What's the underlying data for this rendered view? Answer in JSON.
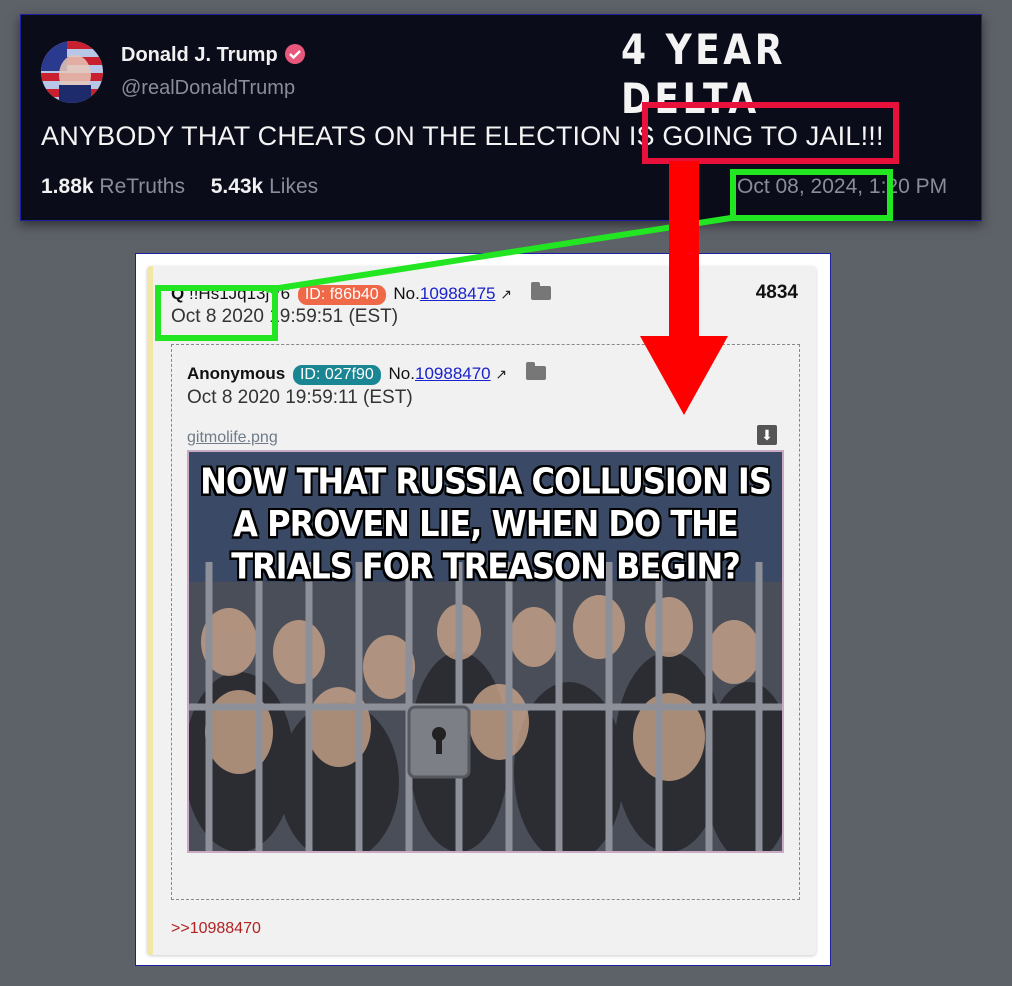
{
  "headline": "4 YEAR DELTA",
  "tweet": {
    "name": "Donald J. Trump",
    "handle": "@realDonaldTrump",
    "text": "ANYBODY THAT CHEATS ON THE ELECTION IS GOING TO JAIL!!!",
    "retruths_count": "1.88k",
    "retruths_label": "ReTruths",
    "likes_count": "5.43k",
    "likes_label": "Likes",
    "date": "Oct 08, 2024, 1:20 PM"
  },
  "post": {
    "author": "Q",
    "tripcode": "!!Hs1Jq13jV6",
    "id": "ID: f86b40",
    "no_label": "No.",
    "no": "10988475",
    "date": "Oct 8 2020 19:59:51 (EST)",
    "count": "4834",
    "reply_link": ">>10988470"
  },
  "quoted": {
    "author": "Anonymous",
    "id": "ID: 027f90",
    "no_label": "No.",
    "no": "10988470",
    "date": "Oct 8 2020 19:59:11 (EST)",
    "filename": "gitmolife.png",
    "image_text": "NOW THAT RUSSIA COLLUSION IS A PROVEN LIE, WHEN DO THE TRIALS FOR TREASON BEGIN?"
  },
  "colors": {
    "highlight_red": "#e8113c",
    "highlight_green": "#22e622",
    "arrow_red": "#ff0000"
  }
}
